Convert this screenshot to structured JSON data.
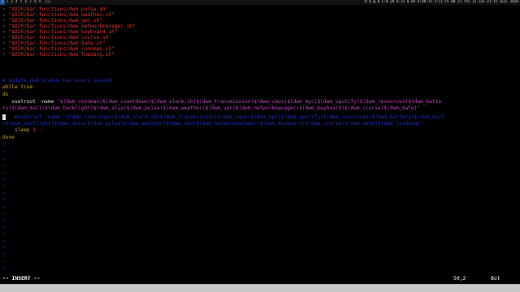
{
  "bar": {
    "tags": [
      "1",
      "2",
      "3",
      "4",
      "5",
      "6",
      "7",
      "8",
      "9"
    ],
    "active_tag": "1",
    "layout_symbol": "[]=",
    "status": "⟲ 0  ▤ 0  L:0.20 0.15 0.09  A:08:15 5:11:15 KW 23 Thu 11 Jun 23:15 CEST 2020"
  },
  "editor": {
    "lines": [
      {
        "kind": "str",
        "prefix": "· ",
        "text": "\"$DIR/bar-functions/dwm_pulse.sh\""
      },
      {
        "kind": "str",
        "prefix": "· ",
        "text": "\"$DIR/bar-functions/dwm_weather.sh\""
      },
      {
        "kind": "str",
        "prefix": "· ",
        "text": "\"$DIR/bar-functions/dwm_vpn.sh\""
      },
      {
        "kind": "str",
        "prefix": "· ",
        "text": "\"$DIR/bar-functions/dwm_networkmanager.sh\""
      },
      {
        "kind": "str",
        "prefix": "· ",
        "text": "\"$DIR/bar-functions/dwm_keyboard.sh\""
      },
      {
        "kind": "str",
        "prefix": "· ",
        "text": "\"$DIR/bar-functions/dwm_ccurse.sh\""
      },
      {
        "kind": "str",
        "prefix": "· ",
        "text": "\"$DIR/bar-functions/dwm_date.sh\""
      },
      {
        "kind": "str",
        "prefix": "· ",
        "text": "\"$DIR/bar-functions/dwm_connman.sh\""
      },
      {
        "kind": "str",
        "prefix": "· ",
        "text": "\"$DIR/bar-functions/dwm_loadavg.sh\""
      }
    ],
    "comment_line": "# Update dwm status bar every second",
    "while_line": "while true",
    "do_line": "do",
    "xsetroot_cmd": "xsetroot",
    "xsetroot_flag": " -name ",
    "xsetroot_str_a": "\"$(dwm_connman)$(dwm_countdown)$(dwm_alarm.sh)$(dwm_transmission)$(dwm_cmus)$(dwm_mpc)$(dwm_spotify)$(dwm_resources)$(dwm_batte",
    "xsetroot_str_b": "ry)$(dwm_mail)$(dwm_backlight)$(dwm_alsa)$(dwm_pulse)$(dwm_weather)$(dwm_vpn)$(dwm_networkmanager)$(dwm_keyboard)$(dwm_ccurse)$(dwm_date)\"",
    "comment2_a": "   #xsetroot -name \"$(dwm_countdown)$(dwm_alarm.sh)$(dwm_transmission)$(dwm_cmus)$(dwm_mpc)$(dwm_spotify)$(dwm_resources)$(dwm_battery)$(dwm_mail",
    "comment2_b": ")$(dwm_backlight)$(dwm_alsa)$(dwm_pulse)$(dwm_weather)$(dwm_vpn)$(dwm_networkmanager)$(dwm_keyboard)$(dwm_ccurse)$(dwm_date)$(dwm_loadavg)\"",
    "sleep_kw": "    sleep",
    "sleep_val": " 1",
    "done_line": "done",
    "tilde": "~"
  },
  "statusline": {
    "mode": "-- INSERT --",
    "position": "50,2",
    "scroll": "Bot"
  },
  "colors": {
    "string": "#e0302a",
    "comment": "#1e2fc2",
    "keyword": "#c9a100",
    "tilde": "#2a3fd6"
  }
}
